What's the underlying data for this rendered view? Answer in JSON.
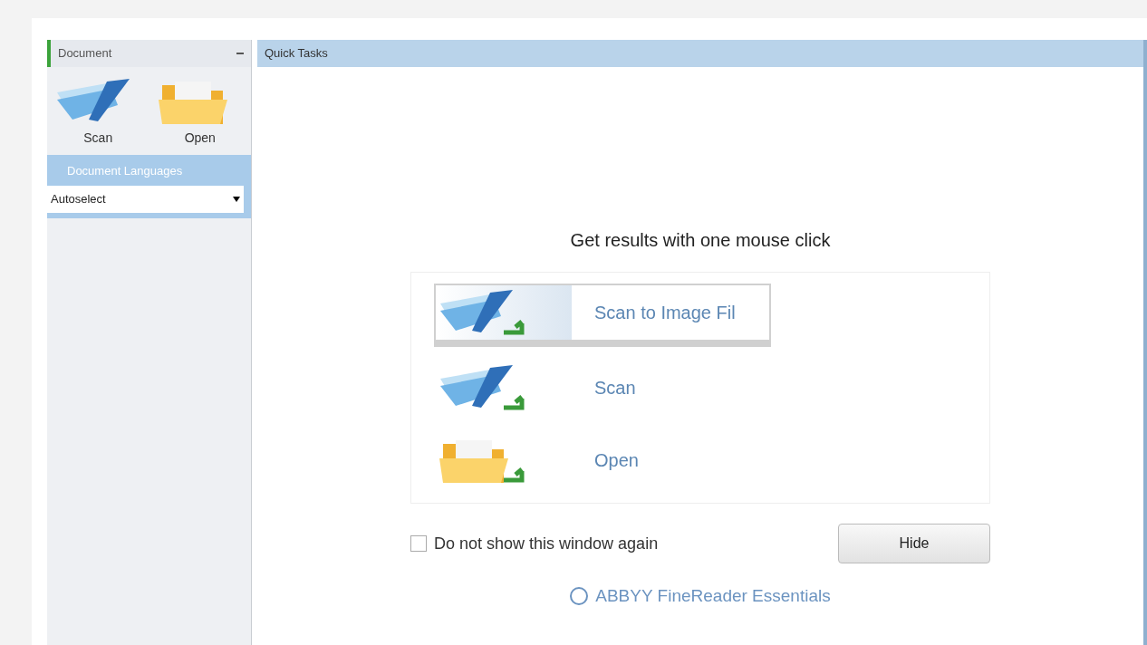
{
  "sidebar": {
    "header": "Document",
    "buttons": [
      {
        "label": "Scan",
        "kind": "scan"
      },
      {
        "label": "Open",
        "kind": "open"
      }
    ],
    "languages": {
      "title": "Document Languages",
      "value": "Autoselect"
    }
  },
  "main": {
    "header": "Quick Tasks",
    "heading": "Get results with one mouse click",
    "tasks": [
      {
        "label": "Scan to Image Fil",
        "kind": "scan",
        "selected": true
      },
      {
        "label": "Scan",
        "kind": "scan",
        "selected": false
      },
      {
        "label": "Open",
        "kind": "open",
        "selected": false
      }
    ],
    "checkbox": {
      "label": "Do not show this window again",
      "checked": false
    },
    "hide_button": "Hide",
    "footer_link": "ABBYY FineReader Essentials"
  }
}
